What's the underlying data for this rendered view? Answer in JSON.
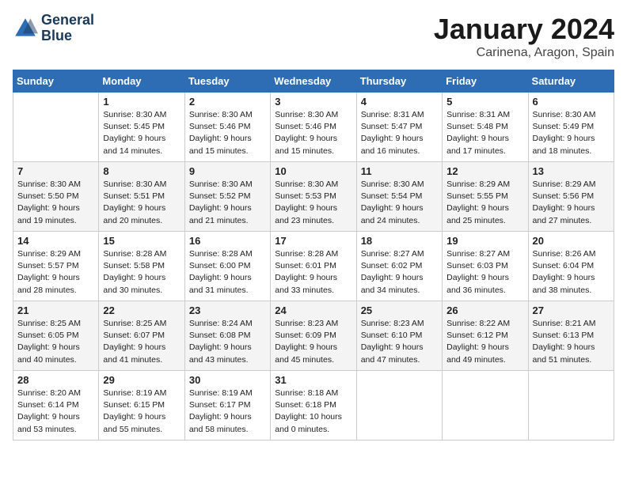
{
  "header": {
    "logo_line1": "General",
    "logo_line2": "Blue",
    "title": "January 2024",
    "subtitle": "Carinena, Aragon, Spain"
  },
  "days_of_week": [
    "Sunday",
    "Monday",
    "Tuesday",
    "Wednesday",
    "Thursday",
    "Friday",
    "Saturday"
  ],
  "weeks": [
    [
      {
        "day": "",
        "info": ""
      },
      {
        "day": "1",
        "info": "Sunrise: 8:30 AM\nSunset: 5:45 PM\nDaylight: 9 hours\nand 14 minutes."
      },
      {
        "day": "2",
        "info": "Sunrise: 8:30 AM\nSunset: 5:46 PM\nDaylight: 9 hours\nand 15 minutes."
      },
      {
        "day": "3",
        "info": "Sunrise: 8:30 AM\nSunset: 5:46 PM\nDaylight: 9 hours\nand 15 minutes."
      },
      {
        "day": "4",
        "info": "Sunrise: 8:31 AM\nSunset: 5:47 PM\nDaylight: 9 hours\nand 16 minutes."
      },
      {
        "day": "5",
        "info": "Sunrise: 8:31 AM\nSunset: 5:48 PM\nDaylight: 9 hours\nand 17 minutes."
      },
      {
        "day": "6",
        "info": "Sunrise: 8:30 AM\nSunset: 5:49 PM\nDaylight: 9 hours\nand 18 minutes."
      }
    ],
    [
      {
        "day": "7",
        "info": "Sunrise: 8:30 AM\nSunset: 5:50 PM\nDaylight: 9 hours\nand 19 minutes."
      },
      {
        "day": "8",
        "info": "Sunrise: 8:30 AM\nSunset: 5:51 PM\nDaylight: 9 hours\nand 20 minutes."
      },
      {
        "day": "9",
        "info": "Sunrise: 8:30 AM\nSunset: 5:52 PM\nDaylight: 9 hours\nand 21 minutes."
      },
      {
        "day": "10",
        "info": "Sunrise: 8:30 AM\nSunset: 5:53 PM\nDaylight: 9 hours\nand 23 minutes."
      },
      {
        "day": "11",
        "info": "Sunrise: 8:30 AM\nSunset: 5:54 PM\nDaylight: 9 hours\nand 24 minutes."
      },
      {
        "day": "12",
        "info": "Sunrise: 8:29 AM\nSunset: 5:55 PM\nDaylight: 9 hours\nand 25 minutes."
      },
      {
        "day": "13",
        "info": "Sunrise: 8:29 AM\nSunset: 5:56 PM\nDaylight: 9 hours\nand 27 minutes."
      }
    ],
    [
      {
        "day": "14",
        "info": "Sunrise: 8:29 AM\nSunset: 5:57 PM\nDaylight: 9 hours\nand 28 minutes."
      },
      {
        "day": "15",
        "info": "Sunrise: 8:28 AM\nSunset: 5:58 PM\nDaylight: 9 hours\nand 30 minutes."
      },
      {
        "day": "16",
        "info": "Sunrise: 8:28 AM\nSunset: 6:00 PM\nDaylight: 9 hours\nand 31 minutes."
      },
      {
        "day": "17",
        "info": "Sunrise: 8:28 AM\nSunset: 6:01 PM\nDaylight: 9 hours\nand 33 minutes."
      },
      {
        "day": "18",
        "info": "Sunrise: 8:27 AM\nSunset: 6:02 PM\nDaylight: 9 hours\nand 34 minutes."
      },
      {
        "day": "19",
        "info": "Sunrise: 8:27 AM\nSunset: 6:03 PM\nDaylight: 9 hours\nand 36 minutes."
      },
      {
        "day": "20",
        "info": "Sunrise: 8:26 AM\nSunset: 6:04 PM\nDaylight: 9 hours\nand 38 minutes."
      }
    ],
    [
      {
        "day": "21",
        "info": "Sunrise: 8:25 AM\nSunset: 6:05 PM\nDaylight: 9 hours\nand 40 minutes."
      },
      {
        "day": "22",
        "info": "Sunrise: 8:25 AM\nSunset: 6:07 PM\nDaylight: 9 hours\nand 41 minutes."
      },
      {
        "day": "23",
        "info": "Sunrise: 8:24 AM\nSunset: 6:08 PM\nDaylight: 9 hours\nand 43 minutes."
      },
      {
        "day": "24",
        "info": "Sunrise: 8:23 AM\nSunset: 6:09 PM\nDaylight: 9 hours\nand 45 minutes."
      },
      {
        "day": "25",
        "info": "Sunrise: 8:23 AM\nSunset: 6:10 PM\nDaylight: 9 hours\nand 47 minutes."
      },
      {
        "day": "26",
        "info": "Sunrise: 8:22 AM\nSunset: 6:12 PM\nDaylight: 9 hours\nand 49 minutes."
      },
      {
        "day": "27",
        "info": "Sunrise: 8:21 AM\nSunset: 6:13 PM\nDaylight: 9 hours\nand 51 minutes."
      }
    ],
    [
      {
        "day": "28",
        "info": "Sunrise: 8:20 AM\nSunset: 6:14 PM\nDaylight: 9 hours\nand 53 minutes."
      },
      {
        "day": "29",
        "info": "Sunrise: 8:19 AM\nSunset: 6:15 PM\nDaylight: 9 hours\nand 55 minutes."
      },
      {
        "day": "30",
        "info": "Sunrise: 8:19 AM\nSunset: 6:17 PM\nDaylight: 9 hours\nand 58 minutes."
      },
      {
        "day": "31",
        "info": "Sunrise: 8:18 AM\nSunset: 6:18 PM\nDaylight: 10 hours\nand 0 minutes."
      },
      {
        "day": "",
        "info": ""
      },
      {
        "day": "",
        "info": ""
      },
      {
        "day": "",
        "info": ""
      }
    ]
  ]
}
